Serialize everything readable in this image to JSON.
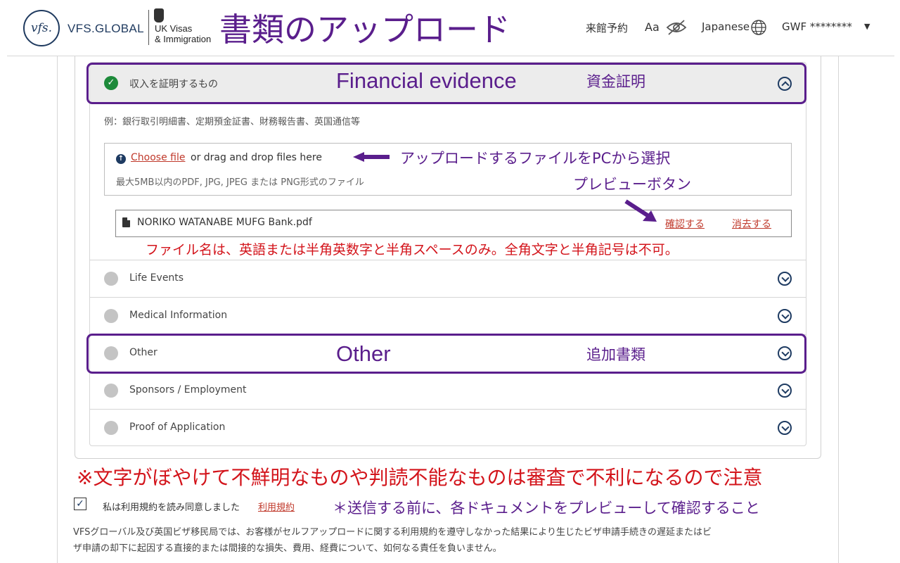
{
  "header": {
    "logo_mark": "vfs.",
    "logo_text": "VFS.GLOBAL",
    "ukvi_line1": "UK Visas",
    "ukvi_line2": "& Immigration",
    "page_title": "書類のアップロード",
    "nav": {
      "appointment": "来館予約",
      "text_size": "Aa",
      "language": "Japanese",
      "user": "GWF ********"
    }
  },
  "sections": {
    "financial": {
      "label": "収入を証明するもの",
      "status": "complete",
      "example": "例：銀行取引明細書、定期預金証書、財務報告書、英国通信等",
      "upload": {
        "choose_label": "Choose file",
        "drag_text": "or drag and drop files here",
        "limit_text": "最大5MB以内のPDF, JPG, JPEG または PNG形式のファイル"
      },
      "file": {
        "name": "NORIKO WATANABE MUFG Bank.pdf",
        "preview_label": "確認する",
        "delete_label": "消去する"
      }
    },
    "life_events": {
      "label": "Life Events"
    },
    "medical": {
      "label": "Medical Information"
    },
    "other": {
      "label": "Other"
    },
    "sponsors": {
      "label": "Sponsors / Employment"
    },
    "proof": {
      "label": "Proof of Application"
    }
  },
  "annotations": {
    "financial_en": "Financial evidence",
    "financial_ja": "資金証明",
    "choose_hint": "アップロードするファイルをPCから選択",
    "preview_hint": "プレビューボタン",
    "filename_rule": "ファイル名は、英語または半角英数字と半角スペースのみ。全角文字と半角記号は不可。",
    "other_en": "Other",
    "other_ja": "追加書類",
    "blurry_warning": "※文字がぼやけて不鮮明なものや判読不能なものは審査で不利になるので注意",
    "preview_reminder": "＊送信する前に、各ドキュメントをプレビューして確認すること"
  },
  "footer": {
    "agree_text": "私は利用規約を読み同意しました",
    "terms_link": "利用規約",
    "agree_checked": true,
    "disclaimer_line1": "VFSグローバル及び英国ビザ移民局では、お客様がセルフアップロードに関する利用規約を遵守しなかった結果により生じたビザ申請手続きの遅延またはビ",
    "disclaimer_line2": "ザ申請の却下に起因する直接的または間接的な損失、費用、経費について、如何なる責任を負いません。"
  },
  "colors": {
    "annotation_purple": "#5a1e8c",
    "annotation_red": "#d3141b",
    "link_red": "#c0392b",
    "navy": "#1e3b62",
    "success_green": "#1d8a3a"
  }
}
